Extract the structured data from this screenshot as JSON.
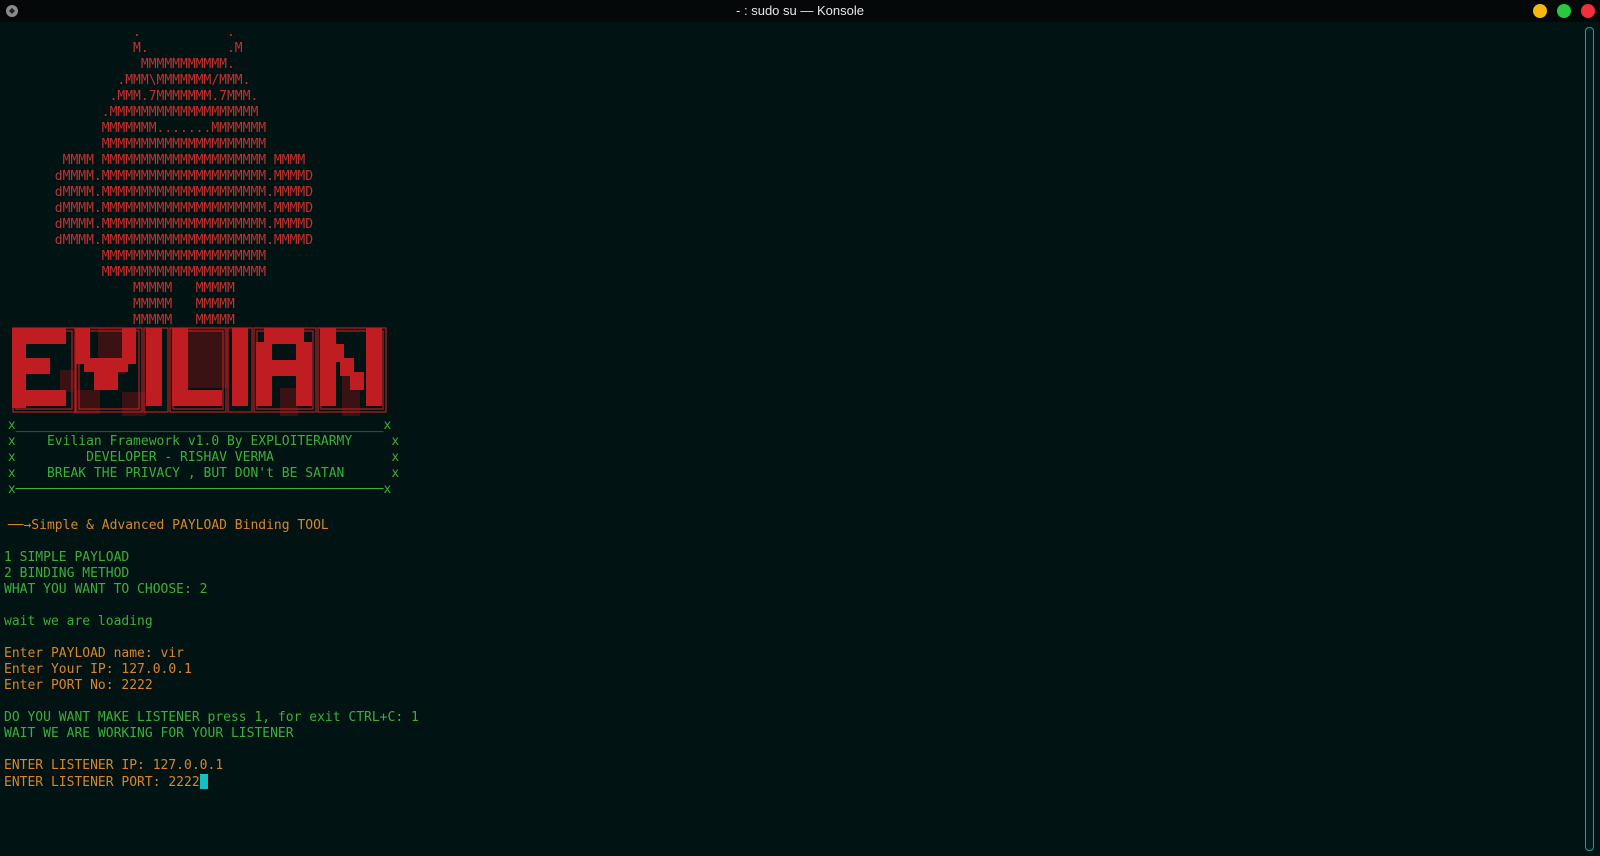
{
  "window": {
    "title": "- : sudo su — Konsole"
  },
  "ascii_art": "                 .           .\n                 M.          .M\n                  MMMMMMMMMMM.\n               .MMM\\MMMMMMM/MMM.\n              .MMM.7MMMMMMM.7MMM.\n             .MMMMMMMMMMMMMMMMMMM\n             MMMMMMM.......MMMMMMM\n             MMMMMMMMMMMMMMMMMMMMM\n        MMMM MMMMMMMMMMMMMMMMMMMMM MMMM\n       dMMMM.MMMMMMMMMMMMMMMMMMMMM.MMMMD\n       dMMMM.MMMMMMMMMMMMMMMMMMMMM.MMMMD\n       dMMMM.MMMMMMMMMMMMMMMMMMMMM.MMMMD\n       dMMMM.MMMMMMMMMMMMMMMMMMMMM.MMMMD\n       dMMMM.MMMMMMMMMMMMMMMMMMMMM.MMMMD\n             MMMMMMMMMMMMMMMMMMMMM\n             MMMMMMMMMMMMMMMMMMMMM\n                 MMMMM   MMMMM\n                 MMMMM   MMMMM\n                 MMMMM   MMMMM",
  "logo": {
    "text": "EVILIAN"
  },
  "banner": {
    "top_border": " x_______________________________________________x",
    "line1": " x    Evilian Framework v1.0 By EXPLOITERARMY     x",
    "line2": " x         DEVELOPER - RISHAV VERMA               x",
    "line3": " x    BREAK THE PRIVACY , BUT DON't BE SATAN      x",
    "bottom_border": " x───────────────────────────────────────────────x"
  },
  "terminal": {
    "tagline": " ──→Simple & Advanced PAYLOAD Binding TOOL",
    "menu_option_1": "1 SIMPLE PAYLOAD",
    "menu_option_2": "2 BINDING METHOD",
    "choose_prompt": "WHAT YOU WANT TO CHOOSE: 2",
    "loading_msg": "wait we are loading",
    "payload_name": "Enter PAYLOAD name: vir",
    "your_ip": "Enter Your IP: 127.0.0.1",
    "port_no": "Enter PORT No: 2222",
    "listener_prompt": "DO YOU WANT MAKE LISTENER press 1, for exit CTRL+C: 1",
    "working_msg": "WAIT WE ARE WORKING FOR YOUR LISTENER",
    "listener_ip": "ENTER LISTENER IP: 127.0.0.1",
    "listener_port": "ENTER LISTENER PORT: 2222"
  },
  "colors": {
    "background": "#021313",
    "ascii_red": "#c8302e",
    "logo_red": "#bf1d21",
    "text_green": "#3ab03a",
    "text_orange": "#d8862a",
    "cursor": "#17c0c0"
  }
}
